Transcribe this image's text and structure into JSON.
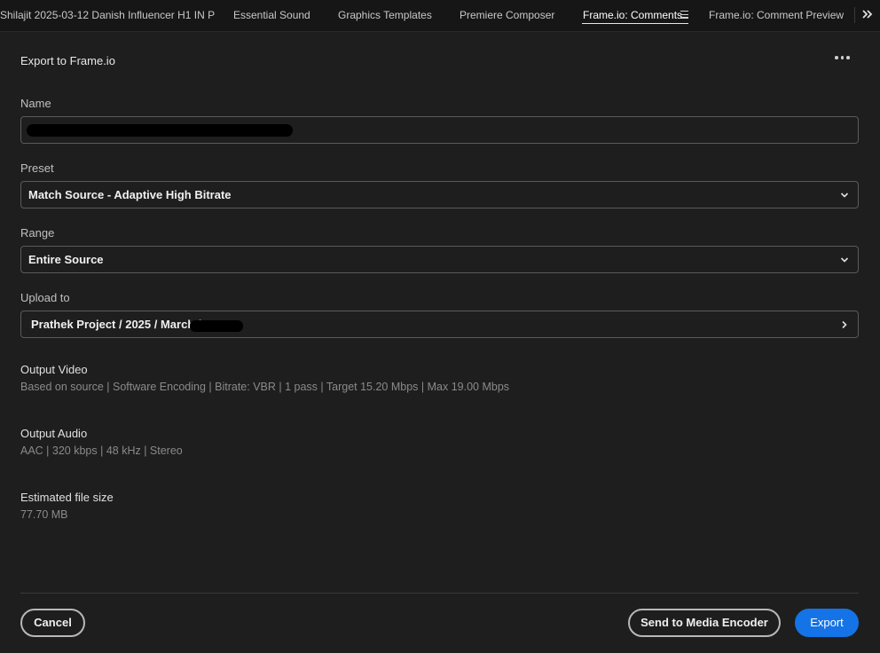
{
  "tabs": [
    {
      "label": "Shilajit 2025-03-12 Danish Influencer H1 IN P"
    },
    {
      "label": "Essential Sound"
    },
    {
      "label": "Graphics Templates"
    },
    {
      "label": "Premiere Composer"
    },
    {
      "label": "Frame.io: Comments"
    },
    {
      "label": "Frame.io: Comment Preview"
    }
  ],
  "active_tab": "Frame.io: Comments",
  "panel": {
    "title": "Export to Frame.io"
  },
  "fields": {
    "name": {
      "label": "Name",
      "value": ""
    },
    "preset": {
      "label": "Preset",
      "value": "Match Source - Adaptive High Bitrate"
    },
    "range": {
      "label": "Range",
      "value": "Entire Source"
    },
    "upload": {
      "label": "Upload to",
      "value": "Prathek Project / 2025 / March /"
    }
  },
  "output_video": {
    "label": "Output Video",
    "detail": "Based on source | Software Encoding | Bitrate: VBR | 1 pass | Target 15.20 Mbps | Max 19.00 Mbps"
  },
  "output_audio": {
    "label": "Output Audio",
    "detail": "AAC | 320 kbps | 48 kHz | Stereo"
  },
  "file_size": {
    "label": "Estimated file size",
    "value": "77.70 MB"
  },
  "buttons": {
    "cancel": "Cancel",
    "send": "Send to Media Encoder",
    "export": "Export"
  },
  "colors": {
    "accent": "#1473e6",
    "background": "#1e1e1e"
  },
  "icons": [
    "hamburger-menu-icon",
    "double-chevron-right-icon",
    "more-options-icon",
    "chevron-down-icon",
    "chevron-right-icon"
  ]
}
